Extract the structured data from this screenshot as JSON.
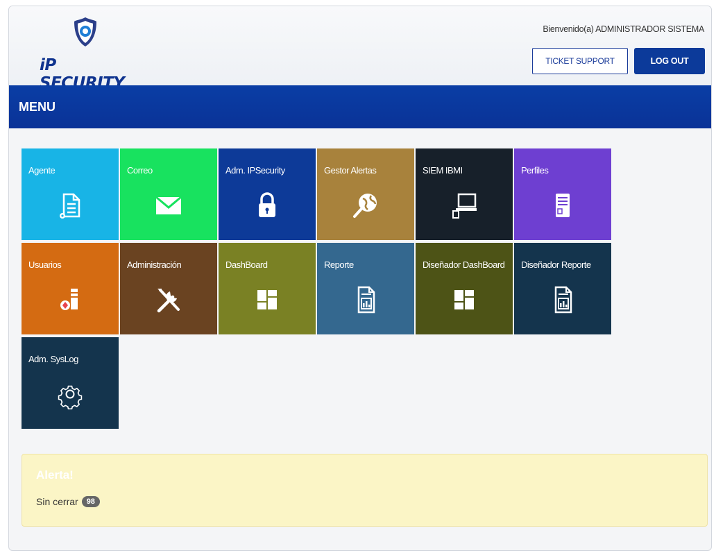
{
  "header": {
    "logo_text": "iP SECURITY",
    "welcome": "Bienvenido(a) ADMINISTRADOR SISTEMA",
    "ticket_label": "TICKET SUPPORT",
    "logout_label": "LOG OUT"
  },
  "menu": {
    "title": "MENU"
  },
  "tiles": [
    {
      "label": "Agente",
      "icon": "document-gear-icon",
      "color": "#18b4e6"
    },
    {
      "label": "Correo",
      "icon": "envelope-icon",
      "color": "#18e25f"
    },
    {
      "label": "Adm. IPSecurity",
      "icon": "lock-icon",
      "color": "#0d3a98"
    },
    {
      "label": "Gestor Alertas",
      "icon": "globe-search-icon",
      "color": "#a8823c"
    },
    {
      "label": "SIEM IBMI",
      "icon": "computer-icon",
      "color": "#17202a"
    },
    {
      "label": "Perfiles",
      "icon": "document-list-icon",
      "color": "#6e3fd1"
    },
    {
      "label": "Usuarios",
      "icon": "user-server-icon",
      "color": "#d46b12"
    },
    {
      "label": "Administración",
      "icon": "tools-icon",
      "color": "#6a4321"
    },
    {
      "label": "DashBoard",
      "icon": "dashboard-icon",
      "color": "#7a8124"
    },
    {
      "label": "Reporte",
      "icon": "report-icon",
      "color": "#34688f"
    },
    {
      "label": "Diseñador DashBoard",
      "icon": "dashboard-icon",
      "color": "#4d5316"
    },
    {
      "label": "Diseñador Reporte",
      "icon": "report-icon",
      "color": "#14344d"
    },
    {
      "label": "Adm. SysLog",
      "icon": "gear-icon",
      "color": "#14344d"
    }
  ],
  "alert": {
    "title": "Alerta!",
    "label": "Sin cerrar",
    "count": "98"
  }
}
